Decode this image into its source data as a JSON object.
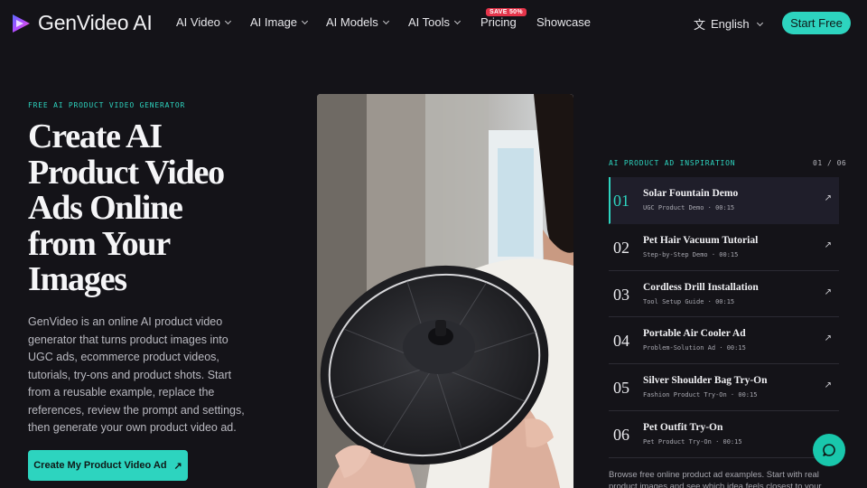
{
  "brand": {
    "name": "GenVideo AI"
  },
  "nav": {
    "items": [
      {
        "label": "AI Video",
        "has_dropdown": true
      },
      {
        "label": "AI Image",
        "has_dropdown": true
      },
      {
        "label": "AI Models",
        "has_dropdown": true
      },
      {
        "label": "AI Tools",
        "has_dropdown": true
      },
      {
        "label": "Pricing",
        "has_dropdown": false
      },
      {
        "label": "Showcase",
        "has_dropdown": false
      }
    ],
    "pricing_badge": "SAVE 50%",
    "language": "English",
    "language_icon": "translate-icon",
    "start_button": "Start Free"
  },
  "hero": {
    "eyebrow": "FREE AI PRODUCT VIDEO GENERATOR",
    "title": "Create AI Product Video Ads Online from Your Images",
    "description": "GenVideo is an online AI product video generator that turns product images into UGC ads, ecommerce product videos, tutorials, try-ons and product shots. Start from a reusable example, replace the references, review the prompt and settings, then generate your own product video ad.",
    "cta": "Create My Product Video Ad",
    "cta_icon": "arrow-up-right-icon"
  },
  "inspiration": {
    "label": "AI PRODUCT AD INSPIRATION",
    "counter": "01 / 06",
    "items": [
      {
        "num": "01",
        "title": "Solar Fountain Demo",
        "subtitle": "UGC Product Demo · 00:15",
        "active": true
      },
      {
        "num": "02",
        "title": "Pet Hair Vacuum Tutorial",
        "subtitle": "Step-by-Step Demo · 00:15",
        "active": false
      },
      {
        "num": "03",
        "title": "Cordless Drill Installation",
        "subtitle": "Tool Setup Guide · 00:15",
        "active": false
      },
      {
        "num": "04",
        "title": "Portable Air Cooler Ad",
        "subtitle": "Problem-Solution Ad · 00:15",
        "active": false
      },
      {
        "num": "05",
        "title": "Silver Shoulder Bag Try-On",
        "subtitle": "Fashion Product Try-On · 00:15",
        "active": false
      },
      {
        "num": "06",
        "title": "Pet Outfit Try-On",
        "subtitle": "Pet Product Try-On · 00:15",
        "active": false
      }
    ],
    "footer": "Browse free online product ad examples. Start with real product images and see which idea feels closest to your brand, your"
  },
  "colors": {
    "accent": "#2dd4bf",
    "background": "#141318",
    "badge": "#e5344a"
  }
}
